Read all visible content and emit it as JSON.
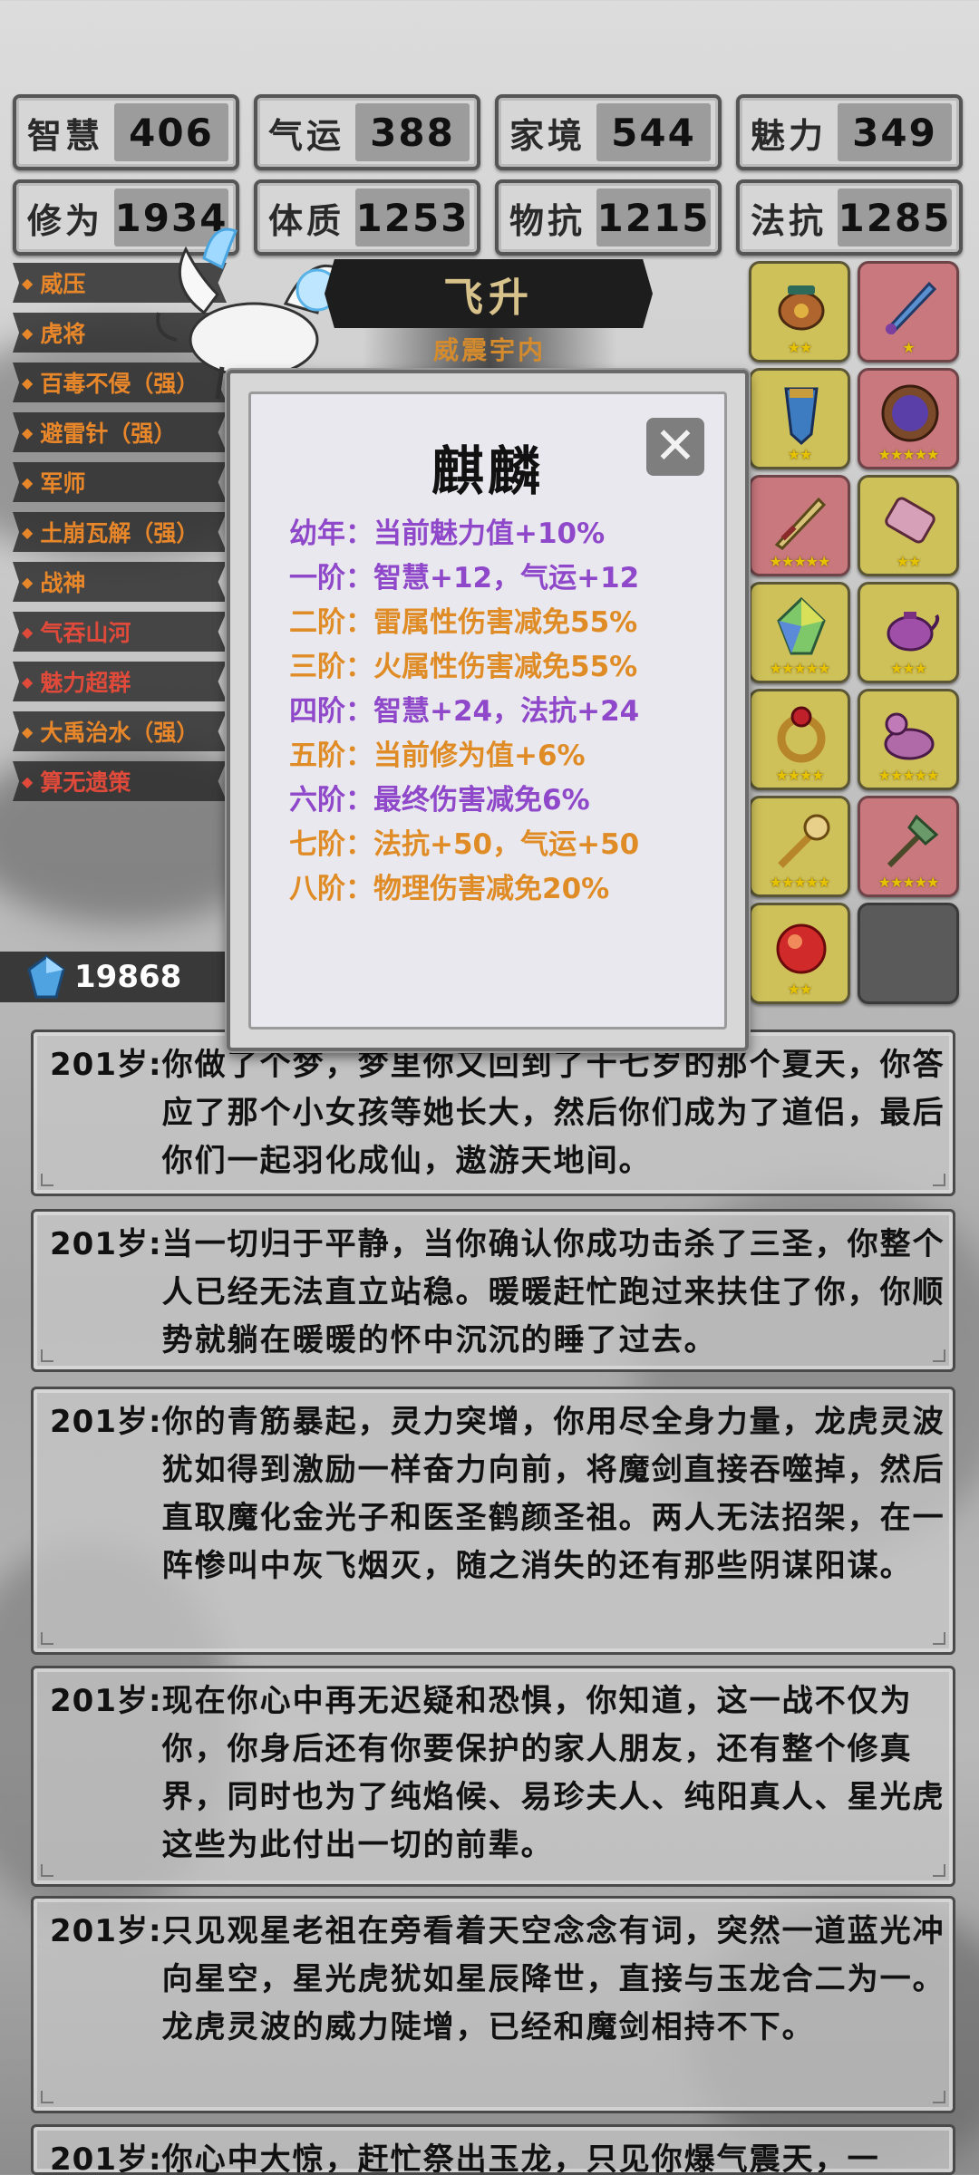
{
  "stats": [
    {
      "label": "智慧",
      "value": "406"
    },
    {
      "label": "气运",
      "value": "388"
    },
    {
      "label": "家境",
      "value": "544"
    },
    {
      "label": "魅力",
      "value": "349"
    },
    {
      "label": "修为",
      "value": "1934"
    },
    {
      "label": "体质",
      "value": "1253"
    },
    {
      "label": "物抗",
      "value": "1215"
    },
    {
      "label": "法抗",
      "value": "1285"
    }
  ],
  "traits": [
    {
      "label": "威压",
      "color": "orange"
    },
    {
      "label": "虎将",
      "color": "orange"
    },
    {
      "label": "百毒不侵（强）",
      "color": "orange"
    },
    {
      "label": "避雷针（强）",
      "color": "orange"
    },
    {
      "label": "军师",
      "color": "orange"
    },
    {
      "label": "土崩瓦解（强）",
      "color": "orange"
    },
    {
      "label": "战神",
      "color": "orange"
    },
    {
      "label": "气吞山河",
      "color": "red"
    },
    {
      "label": "魅力超群",
      "color": "red"
    },
    {
      "label": "大禹治水（强）",
      "color": "orange"
    },
    {
      "label": "算无遗策",
      "color": "red"
    }
  ],
  "title_banner": "飞升",
  "subtitle": "威震宇内",
  "gems": "19868",
  "equipment": [
    {
      "icon": "bronze-cauldron-icon",
      "bg": "gold",
      "stars": 2
    },
    {
      "icon": "jade-sword-icon",
      "bg": "red",
      "stars": 1
    },
    {
      "icon": "spirit-crystal-icon",
      "bg": "gold",
      "stars": 2
    },
    {
      "icon": "mirror-orb-icon",
      "bg": "red",
      "stars": 5
    },
    {
      "icon": "golden-sword-icon",
      "bg": "red",
      "stars": 5
    },
    {
      "icon": "scroll-icon",
      "bg": "gold",
      "stars": 2
    },
    {
      "icon": "rainbow-gem-icon",
      "bg": "gold",
      "stars": 5
    },
    {
      "icon": "purple-teapot-icon",
      "bg": "gold",
      "stars": 3
    },
    {
      "icon": "ruby-ring-icon",
      "bg": "gold",
      "stars": 4
    },
    {
      "icon": "purple-duck-icon",
      "bg": "gold",
      "stars": 5
    },
    {
      "icon": "golden-staff-icon",
      "bg": "gold",
      "stars": 5
    },
    {
      "icon": "green-axe-icon",
      "bg": "red",
      "stars": 5
    },
    {
      "icon": "fire-pearl-icon",
      "bg": "gold",
      "stars": 2
    },
    {
      "icon": "",
      "bg": "empty",
      "stars": 0
    }
  ],
  "popup": {
    "title": "麒麟",
    "close": "✕",
    "lines": [
      {
        "text": "幼年：当前魅力值+10%",
        "color": "purple"
      },
      {
        "text": "一阶：智慧+12，气运+12",
        "color": "purple"
      },
      {
        "text": "二阶：雷属性伤害减免55%",
        "color": "orange"
      },
      {
        "text": "三阶：火属性伤害减免55%",
        "color": "orange"
      },
      {
        "text": "四阶：智慧+24，法抗+24",
        "color": "purple"
      },
      {
        "text": "五阶：当前修为值+6%",
        "color": "orange"
      },
      {
        "text": "六阶：最终伤害减免6%",
        "color": "purple"
      },
      {
        "text": "七阶：法抗+50，气运+50",
        "color": "orange"
      },
      {
        "text": "八阶：物理伤害减免20%",
        "color": "orange"
      }
    ]
  },
  "log": [
    {
      "age": "201岁:",
      "text": "你做了个梦，梦里你又回到了十七岁的那个夏天，你答应了那个小女孩等她长大，然后你们成为了道侣，最后你们一起羽化成仙，遨游天地间。"
    },
    {
      "age": "201岁:",
      "text": "当一切归于平静，当你确认你成功击杀了三圣，你整个人已经无法直立站稳。暖暖赶忙跑过来扶住了你，你顺势就躺在暖暖的怀中沉沉的睡了过去。"
    },
    {
      "age": "201岁:",
      "text": "你的青筋暴起，灵力突增，你用尽全身力量，龙虎灵波犹如得到激励一样奋力向前，将魔剑直接吞噬掉，然后直取魔化金光子和医圣鹤颜圣祖。两人无法招架，在一阵惨叫中灰飞烟灭，随之消失的还有那些阴谋阳谋。"
    },
    {
      "age": "201岁:",
      "text": "现在你心中再无迟疑和恐惧，你知道，这一战不仅为你，你身后还有你要保护的家人朋友，还有整个修真界，同时也为了纯焰候、易珍夫人、纯阳真人、星光虎这些为此付出一切的前辈。"
    },
    {
      "age": "201岁:",
      "text": "只见观星老祖在旁看着天空念念有词，突然一道蓝光冲向星空，星光虎犹如星辰降世，直接与玉龙合二为一。龙虎灵波的威力陡增，已经和魔剑相持不下。"
    },
    {
      "age": "201岁:",
      "text": "你心中大惊，赶忙祭出玉龙，只见你爆气震天，一"
    }
  ]
}
